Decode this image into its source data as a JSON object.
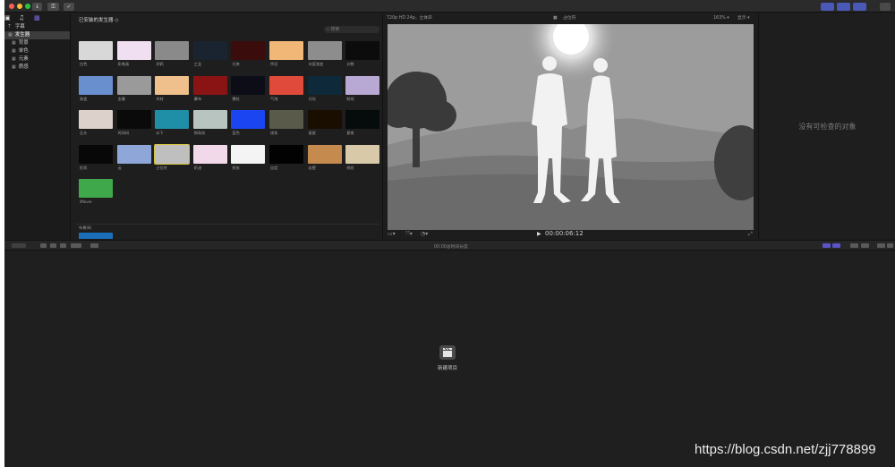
{
  "titlebar": {
    "download_label": "↓",
    "keys_label": "⚿",
    "check_label": "✓"
  },
  "sidebar": {
    "sections": [
      {
        "label": "字幕",
        "icon": "T"
      },
      {
        "label": "发生器",
        "icon": "▦"
      }
    ],
    "items": [
      {
        "label": "背景",
        "icon": "▦"
      },
      {
        "label": "单色",
        "icon": "▦"
      },
      {
        "label": "元素",
        "icon": "▦"
      },
      {
        "label": "质感",
        "icon": "▦"
      }
    ]
  },
  "browser": {
    "title": "已安装的发生器 ◇",
    "search_placeholder": "搜索",
    "section_label": "布景(8)",
    "thumbnails": [
      {
        "label": "白色",
        "color": "#d8d8d8"
      },
      {
        "label": "彩笔画",
        "color": "#f0dff1"
      },
      {
        "label": "涂鸦",
        "color": "#8a8a8a"
      },
      {
        "label": "工业",
        "color": "#1a2430"
      },
      {
        "label": "光束",
        "color": "#3a0c0c"
      },
      {
        "label": "怀旧",
        "color": "#f0b777"
      },
      {
        "label": "灰度渐变",
        "color": "#8d8d8d"
      },
      {
        "label": "计数",
        "color": "#0c0c0c"
      },
      {
        "label": "渐变",
        "color": "#6a8fcf"
      },
      {
        "label": "金属",
        "color": "#9a9a9a"
      },
      {
        "label": "木材",
        "color": "#f0c08c"
      },
      {
        "label": "幕布",
        "color": "#8a1414"
      },
      {
        "label": "霓虹",
        "color": "#0d0d18"
      },
      {
        "label": "气泡",
        "color": "#e04a3a"
      },
      {
        "label": "闪光",
        "color": "#0e2a3a"
      },
      {
        "label": "射线",
        "color": "#b8a8d4"
      },
      {
        "label": "石头",
        "color": "#ddd2cb"
      },
      {
        "label": "时间码",
        "color": "#0a0a0a"
      },
      {
        "label": "水下",
        "color": "#1f8fa8"
      },
      {
        "label": "铜条纹",
        "color": "#b8c4c0"
      },
      {
        "label": "蓝色",
        "color": "#1a45f0"
      },
      {
        "label": "线条",
        "color": "#5a5a4a"
      },
      {
        "label": "星星",
        "color": "#1a0e00"
      },
      {
        "label": "星夜",
        "color": "#060b0b"
      },
      {
        "label": "形状",
        "color": "#080808"
      },
      {
        "label": "云",
        "color": "#8fa6d8"
      },
      {
        "label": "占位符",
        "color": "#bfbfbf"
      },
      {
        "label": "奶油",
        "color": "#f2d9e9"
      },
      {
        "label": "纸张",
        "color": "#f4f4f4"
      },
      {
        "label": "自定",
        "color": "#020202"
      },
      {
        "label": "岩壁",
        "color": "#c48a4e"
      },
      {
        "label": "纸纹",
        "color": "#d8caa8"
      },
      {
        "label": "iMovie",
        "color": "#3fa84a"
      }
    ]
  },
  "viewer": {
    "format": "720p HD 24p，立体声",
    "clip_name": "占位符",
    "zoom": "163% ▾",
    "display_menu": "显示 ▾",
    "timecode": "00:00:06:12"
  },
  "inspector": {
    "empty_message": "没有可检查的对象"
  },
  "timeline": {
    "duration_text": "00:00总时间长度",
    "new_project_label": "新建项目"
  },
  "watermark": "https://blog.csdn.net/zjj778899",
  "colors": {
    "traffic_red": "#ff5f57",
    "traffic_yellow": "#febc2e",
    "traffic_green": "#28c840",
    "accent_purple": "#7d67e0",
    "selection_yellow": "#d8c43a"
  }
}
